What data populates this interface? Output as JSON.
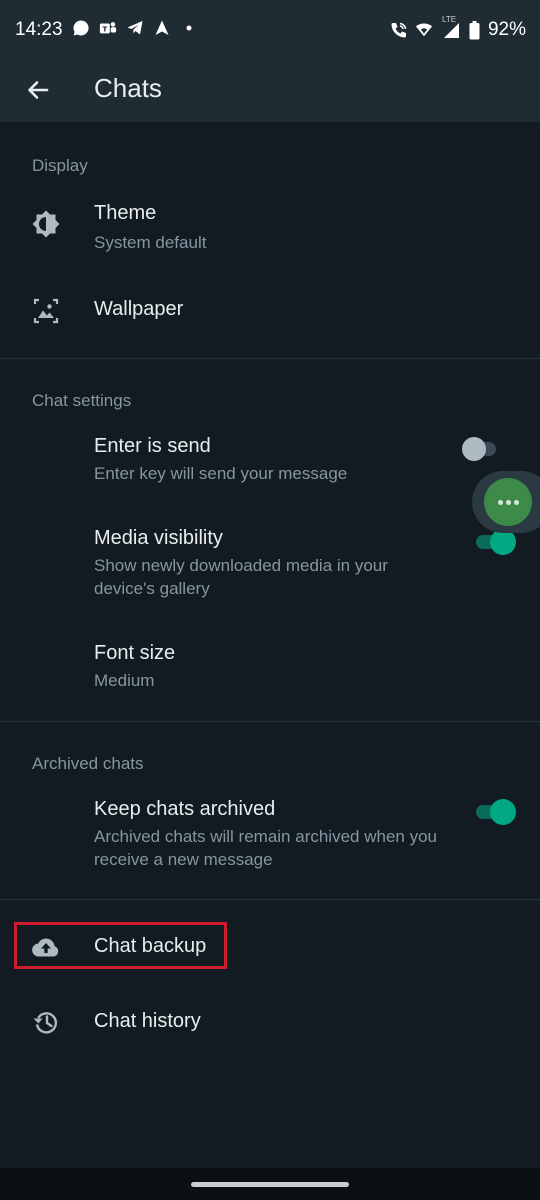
{
  "status_bar": {
    "time": "14:23",
    "network": "LTE",
    "battery": "92%",
    "left_icons": [
      "whatsapp-icon",
      "teams-icon",
      "telegram-icon",
      "navigation-icon",
      "dot-icon"
    ],
    "right_icons": [
      "wifi-call-icon",
      "wifi-icon",
      "signal-icon",
      "battery-icon"
    ]
  },
  "app_bar": {
    "title": "Chats"
  },
  "sections": {
    "display": {
      "header": "Display",
      "theme_title": "Theme",
      "theme_value": "System default",
      "wallpaper_title": "Wallpaper"
    },
    "chat_settings": {
      "header": "Chat settings",
      "enter_send_title": "Enter is send",
      "enter_send_sub": "Enter key will send your message",
      "enter_send_on": false,
      "media_title": "Media visibility",
      "media_sub": "Show newly downloaded media in your device's gallery",
      "media_on": true,
      "font_title": "Font size",
      "font_value": "Medium"
    },
    "archived": {
      "header": "Archived chats",
      "keep_title": "Keep chats archived",
      "keep_sub": "Archived chats will remain archived when you receive a new message",
      "keep_on": true
    },
    "other": {
      "backup_title": "Chat backup",
      "history_title": "Chat history"
    }
  },
  "colors": {
    "background": "#111b21",
    "bar": "#202c33",
    "accent": "#00a884",
    "highlight_box": "#d01a2e"
  }
}
